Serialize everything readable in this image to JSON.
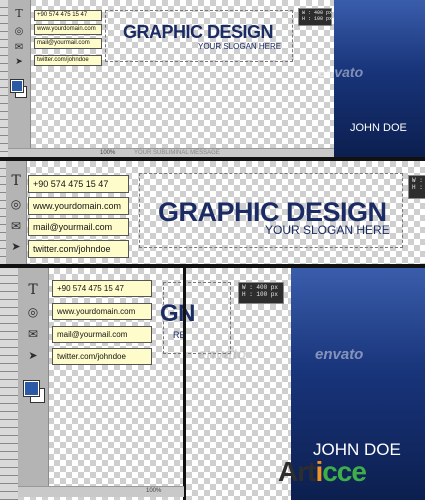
{
  "contact": {
    "phone": "+90 574 475 15 47",
    "website": "www.yourdomain.com",
    "email": "mail@yourmail.com",
    "twitter": "twitter.com/johndoe"
  },
  "card": {
    "title": "GRAPHIC DESIGN",
    "title_cut": "GN",
    "slogan": "YOUR SLOGAN HERE",
    "name": "JOHN DOE",
    "watermark": "envato"
  },
  "dimensions": {
    "w": "W :   400 px",
    "h": "H :   100 px"
  },
  "status": {
    "zoom": "100%",
    "message": "YOUR SUBLIMINAL MESSAGE"
  },
  "brand": {
    "name": "Articce"
  },
  "colors": {
    "card_blue": "#18347a",
    "field_fill": "#fffccc",
    "title_navy": "#1b2b63"
  },
  "icons": {
    "text_tool": "type-icon",
    "web": "globe-icon",
    "mail": "envelope-icon",
    "social": "bird-icon"
  }
}
